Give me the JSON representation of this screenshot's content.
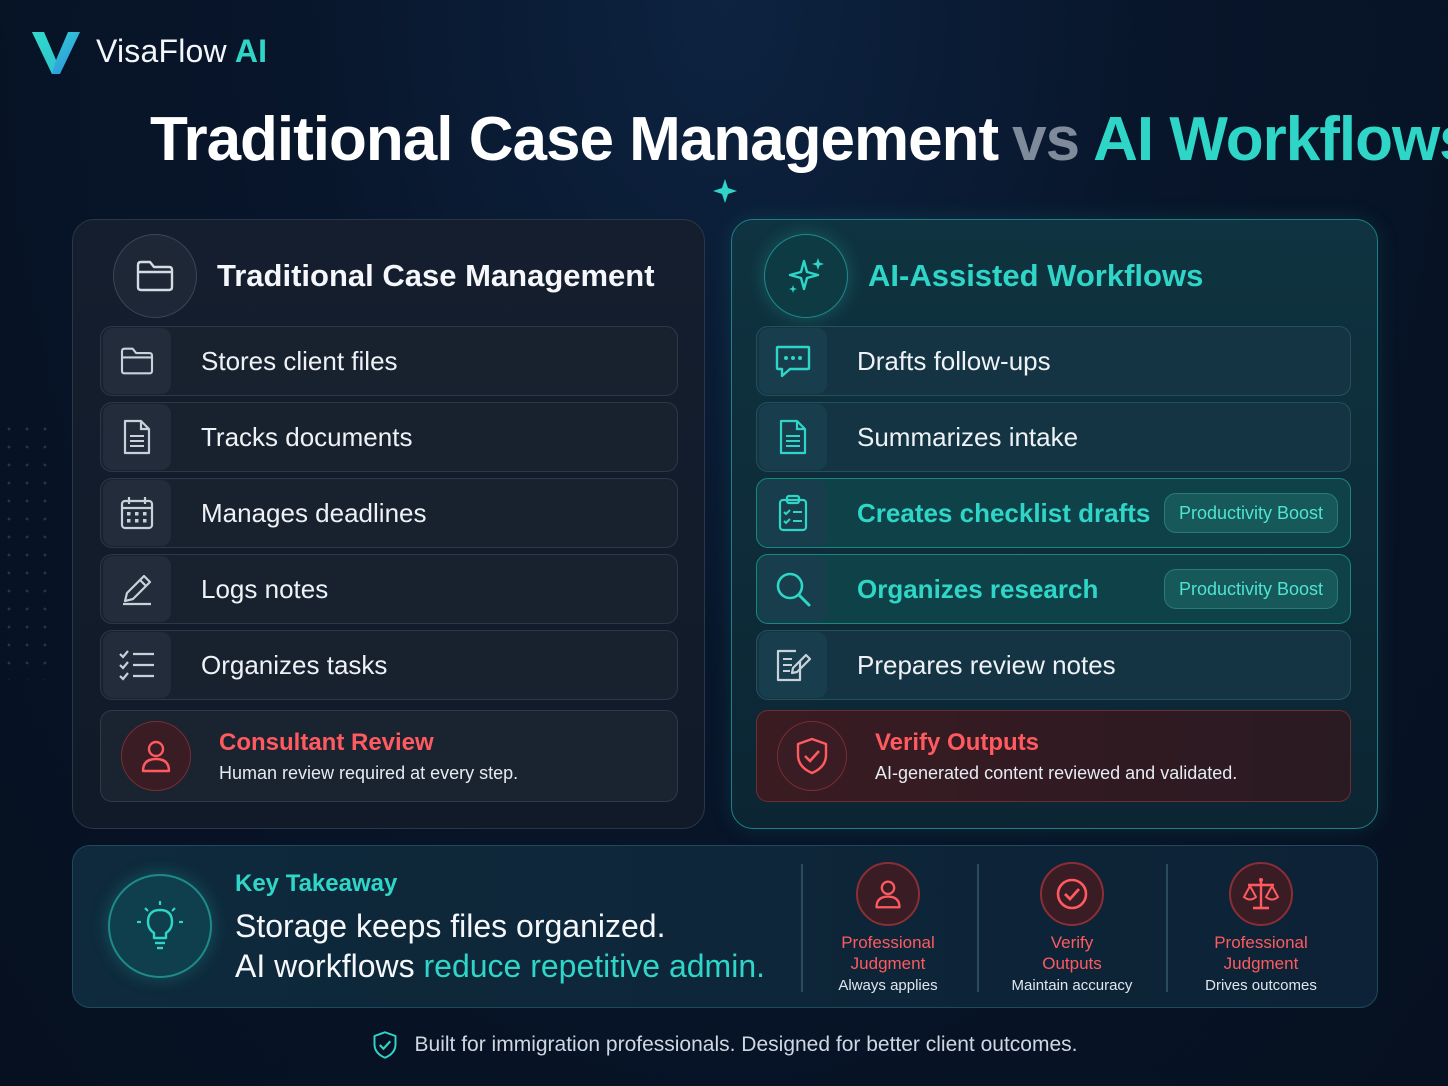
{
  "brand": {
    "name": "VisaFlow",
    "ai": "AI"
  },
  "title": {
    "part1": "Traditional Case Management",
    "vs": "vs",
    "part2": "AI Workflows"
  },
  "left": {
    "title": "Traditional Case Management",
    "items": [
      {
        "label": "Stores client files",
        "icon": "folder-icon"
      },
      {
        "label": "Tracks documents",
        "icon": "document-icon"
      },
      {
        "label": "Manages deadlines",
        "icon": "calendar-icon"
      },
      {
        "label": "Logs notes",
        "icon": "pencil-icon"
      },
      {
        "label": "Organizes tasks",
        "icon": "checklist-icon"
      }
    ],
    "review": {
      "title": "Consultant Review",
      "subtitle": "Human review required at every step."
    }
  },
  "right": {
    "title": "AI-Assisted Workflows",
    "items": [
      {
        "label": "Drafts follow-ups",
        "icon": "chat-icon"
      },
      {
        "label": "Summarizes intake",
        "icon": "document-icon"
      },
      {
        "label": "Creates checklist drafts",
        "icon": "clipboard-icon",
        "badge": "Productivity Boost"
      },
      {
        "label": "Organizes research",
        "icon": "search-icon",
        "badge": "Productivity Boost"
      },
      {
        "label": "Prepares review notes",
        "icon": "edit-note-icon"
      }
    ],
    "review": {
      "title": "Verify Outputs",
      "subtitle": "AI-generated content reviewed and validated."
    }
  },
  "takeaway": {
    "label": "Key Takeaway",
    "line1": "Storage keeps files organized.",
    "line2_prefix": "AI workflows ",
    "line2_highlight": "reduce repetitive admin.",
    "pillars": [
      {
        "title1": "Professional",
        "title2": "Judgment",
        "subtitle": "Always applies",
        "icon": "person-icon"
      },
      {
        "title1": "Verify",
        "title2": "Outputs",
        "subtitle": "Maintain accuracy",
        "icon": "check-circle-icon"
      },
      {
        "title1": "Professional",
        "title2": "Judgment",
        "subtitle": "Drives outcomes",
        "icon": "scales-icon"
      }
    ]
  },
  "footer": "Built for immigration professionals. Designed for better client outcomes.",
  "colors": {
    "accent": "#2fd6c7",
    "alert": "#ff5a5f",
    "background": "#08152a"
  }
}
